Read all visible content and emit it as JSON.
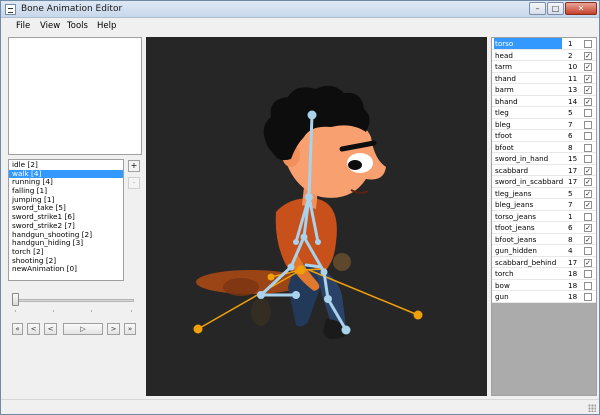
{
  "window": {
    "title": "Bone Animation Editor",
    "controls": {
      "minimize": "–",
      "maximize": "□",
      "close": "✕"
    }
  },
  "menu": [
    "File",
    "View",
    "Tools",
    "Help"
  ],
  "animations": {
    "selected_index": 1,
    "items": [
      "idle [2]",
      "walk [4]",
      "running [4]",
      "falling [1]",
      "jumping [1]",
      "sword_take [5]",
      "sword_strike1 [6]",
      "sword_strike2 [7]",
      "handgun_shooting [2]",
      "handgun_hiding [3]",
      "torch [2]",
      "shooting [2]",
      "newAnimation [0]"
    ]
  },
  "animation_buttons": {
    "add": "+",
    "remove": "-"
  },
  "timeline": {
    "position": 0
  },
  "playback": {
    "first": "«",
    "prev": "<",
    "play": "▷",
    "next": ">",
    "last": "»"
  },
  "bones": {
    "selected_index": 0,
    "rows": [
      {
        "name": "torso",
        "value": "1",
        "checked": false
      },
      {
        "name": "head",
        "value": "2",
        "checked": true
      },
      {
        "name": "tarm",
        "value": "10",
        "checked": true
      },
      {
        "name": "thand",
        "value": "11",
        "checked": true
      },
      {
        "name": "barm",
        "value": "13",
        "checked": true
      },
      {
        "name": "bhand",
        "value": "14",
        "checked": true
      },
      {
        "name": "tleg",
        "value": "5",
        "checked": false
      },
      {
        "name": "bleg",
        "value": "7",
        "checked": false
      },
      {
        "name": "tfoot",
        "value": "6",
        "checked": false
      },
      {
        "name": "bfoot",
        "value": "8",
        "checked": false
      },
      {
        "name": "sword_in_hand",
        "value": "15",
        "checked": false
      },
      {
        "name": "scabbard",
        "value": "17",
        "checked": true
      },
      {
        "name": "sword_in_scabbard",
        "value": "17",
        "checked": true
      },
      {
        "name": "tleg_jeans",
        "value": "5",
        "checked": true
      },
      {
        "name": "bleg_jeans",
        "value": "7",
        "checked": true
      },
      {
        "name": "torso_jeans",
        "value": "1",
        "checked": false
      },
      {
        "name": "tfoot_jeans",
        "value": "6",
        "checked": true
      },
      {
        "name": "bfoot_jeans",
        "value": "8",
        "checked": true
      },
      {
        "name": "gun_hidden",
        "value": "4",
        "checked": false
      },
      {
        "name": "scabbard_behind",
        "value": "17",
        "checked": true
      },
      {
        "name": "torch",
        "value": "18",
        "checked": false
      },
      {
        "name": "bow",
        "value": "18",
        "checked": false
      },
      {
        "name": "gun",
        "value": "18",
        "checked": false
      }
    ]
  },
  "colors": {
    "canvas_bg": "#262626",
    "skin": "#f8a070",
    "hair": "#0d0d0d",
    "shirt": "#c8501a",
    "jeans": "#23395a",
    "bone_blue": "#a9d2ec",
    "bone_orange": "#f2a007",
    "selection": "#3399ff"
  }
}
